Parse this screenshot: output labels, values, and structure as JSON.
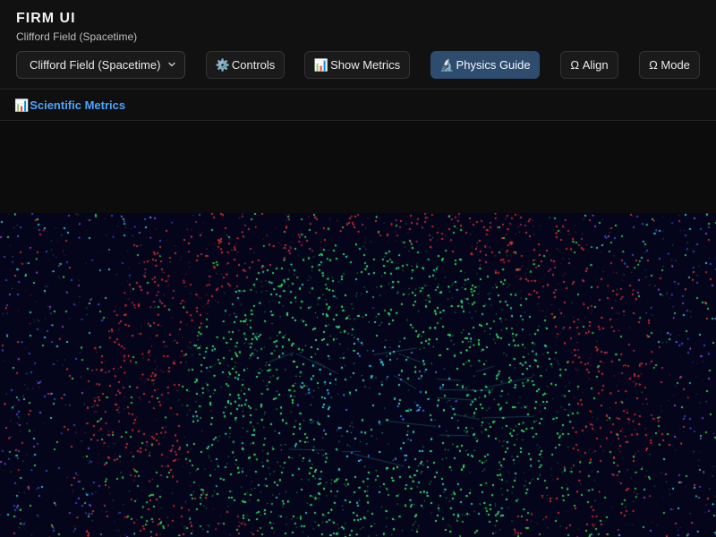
{
  "header": {
    "title": "FIRM UI",
    "subtitle": "Clifford Field (Spacetime)"
  },
  "toolbar": {
    "field_select": {
      "value": "Clifford Field (Spacetime)",
      "icon": "chevron-down-icon"
    },
    "buttons": [
      {
        "label": "Controls",
        "icon": "⚙️"
      },
      {
        "label": "Show Metrics",
        "icon": "📊"
      },
      {
        "label": "Physics Guide",
        "icon": "🔬",
        "active": true
      },
      {
        "label": "Ω Align"
      },
      {
        "label": "Ω Mode"
      }
    ]
  },
  "metrics_panel": {
    "icon": "📊",
    "label": "Scientific Metrics"
  },
  "colors": {
    "background": "#0c0c0c",
    "accent_blue": "#4da3ff",
    "active_button": "#2e4c6e",
    "field_red": "#c83a3a",
    "field_green": "#3ee06a",
    "field_cyan": "#35d8d8",
    "field_blue": "#3a55d8"
  }
}
